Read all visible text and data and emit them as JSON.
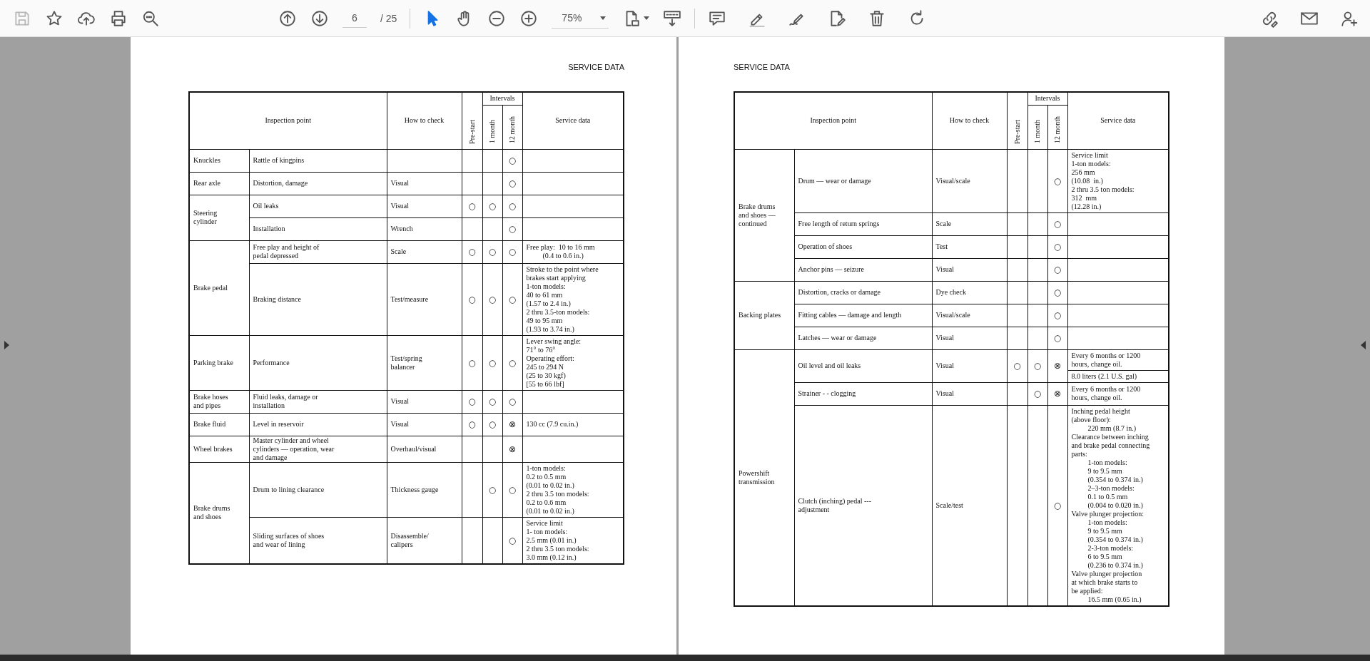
{
  "toolbar": {
    "file_buttons": [
      {
        "kind": "save",
        "disabled": true
      },
      {
        "kind": "bookmark",
        "disabled": false
      },
      {
        "kind": "upload",
        "disabled": false
      },
      {
        "kind": "print",
        "disabled": false
      },
      {
        "kind": "find",
        "disabled": false
      }
    ],
    "nav_buttons": [
      {
        "kind": "prev"
      },
      {
        "kind": "next"
      }
    ],
    "page_field": {
      "value": "6"
    },
    "page_count": "/ 25",
    "tools": [
      {
        "kind": "select",
        "selected": true
      },
      {
        "kind": "hand",
        "selected": false
      }
    ],
    "zoom_buttons": [
      {
        "kind": "zoom_out"
      },
      {
        "kind": "zoom_in"
      }
    ],
    "zoom_field": {
      "value": "75%"
    },
    "view_buttons": [
      {
        "kind": "fit"
      },
      {
        "kind": "scroll"
      }
    ],
    "edit_buttons": [
      {
        "kind": "comment"
      },
      {
        "kind": "highlight"
      },
      {
        "kind": "sign"
      },
      {
        "kind": "edit"
      },
      {
        "kind": "delete"
      },
      {
        "kind": "rotate"
      }
    ],
    "share_buttons": [
      {
        "kind": "link"
      },
      {
        "kind": "mail"
      },
      {
        "kind": "user"
      }
    ]
  },
  "pages": [
    {
      "heading": "SERVICE DATA",
      "columns": {
        "inspection": "Inspection point",
        "check": "How to check",
        "pre_start": "Pre-start",
        "intervals": "Intervals",
        "month_1": "1 month",
        "month_12": "12 month",
        "service": "Service data"
      },
      "groups": [
        {
          "name": "Knuckles",
          "rows": [
            {
              "inspection": "Rattle of kingpins",
              "intervals": {
                "month_12": "○"
              }
            }
          ]
        },
        {
          "name": "Rear axle",
          "rows": [
            {
              "inspection": "Distortion, damage",
              "check": "Visual",
              "intervals": {
                "month_12": "○"
              }
            }
          ]
        },
        {
          "name": "Steering\ncylinder",
          "rows": [
            {
              "inspection": "Oil leaks",
              "check": "Visual",
              "intervals": {
                "pre_start": "○",
                "month_1": "○",
                "month_12": "○"
              }
            },
            {
              "inspection": "Installation",
              "check": "Wrench",
              "intervals": {
                "month_12": "○"
              }
            }
          ]
        },
        {
          "name": "Brake pedal",
          "rows": [
            {
              "inspection": "Free play and height of\npedal depressed",
              "check": "Scale",
              "intervals": {
                "pre_start": "○",
                "month_1": "○",
                "month_12": "○"
              },
              "service_data": [
                [
                  "Free play:  10 to 16 mm",
                  {
                    "text": "(0.4 to 0.6 in.)",
                    "indent": true
                  }
                ]
              ]
            },
            {
              "inspection": "Braking distance",
              "check": "Test/measure",
              "intervals": {
                "pre_start": "○",
                "month_1": "○",
                "month_12": "○"
              },
              "service_data": [
                [
                  "Stroke to the point where",
                  "brakes start applying",
                  "1-ton models:",
                  "40 to 61 mm",
                  "(1.57 to 2.4 in.)",
                  "2 thru 3.5-ton models:",
                  "49 to 95 mm",
                  "(1.93 to 3.74 in.)"
                ]
              ]
            }
          ]
        },
        {
          "name": "Parking brake",
          "rows": [
            {
              "inspection": "Performance",
              "check": "Test/spring\nbalancer",
              "intervals": {
                "pre_start": "○",
                "month_1": "○",
                "month_12": "○"
              },
              "service_data": [
                [
                  "Lever swing angle:",
                  "71° to 76°",
                  "Operating effort:",
                  "245 to 294 N",
                  "(25 to 30 kgf)",
                  "[55 to 66 lbf]"
                ]
              ]
            }
          ]
        },
        {
          "name": "Brake hoses\nand pipes",
          "rows": [
            {
              "inspection": "Fluid leaks, damage or\ninstallation",
              "check": "Visual",
              "intervals": {
                "pre_start": "○",
                "month_1": "○",
                "month_12": "○"
              }
            }
          ]
        },
        {
          "name": "Brake fluid",
          "rows": [
            {
              "inspection": "Level in reservoir",
              "check": "Visual",
              "intervals": {
                "pre_start": "○",
                "month_1": "○",
                "month_12": "⊗"
              },
              "service_data": [
                [
                  "130 cc (7.9 cu.in.)"
                ]
              ]
            }
          ]
        },
        {
          "name": "Wheel brakes",
          "rows": [
            {
              "inspection": "Master cylinder and wheel\ncylinders — operation, wear\nand damage",
              "check": "Overhaul/visual",
              "intervals": {
                "month_12": "⊗"
              }
            }
          ]
        },
        {
          "name": "Brake drums\nand shoes",
          "rows": [
            {
              "inspection": "Drum to lining clearance",
              "check": "Thickness gauge",
              "intervals": {
                "month_1": "○",
                "month_12": "○"
              },
              "service_data": [
                [
                  "1-ton models:",
                  "0.2 to 0.5 mm",
                  "(0.01 to 0.02 in.)",
                  "2 thru 3.5 ton models:",
                  "0.2 to 0.6 mm",
                  "(0.01 to 0.02 in.)"
                ]
              ]
            },
            {
              "inspection": "Sliding surfaces of shoes\nand wear of lining",
              "check": "Disassemble/\ncalipers",
              "intervals": {
                "month_12": "○"
              },
              "service_data": [
                [
                  "Service limit",
                  "1- ton models:",
                  "2.5 mm (0.01 in.)",
                  "2 thru 3.5 ton models:",
                  "3.0 mm (0.12 in.)"
                ]
              ]
            }
          ]
        }
      ]
    },
    {
      "heading": "SERVICE DATA",
      "columns": {
        "inspection": "Inspection point",
        "check": "How to check",
        "pre_start": "Pre-start",
        "intervals": "Intervals",
        "month_1": "1 month",
        "month_12": "12 month",
        "service": "Service data"
      },
      "groups": [
        {
          "name": "Brake drums\nand shoes —\ncontinued",
          "rows": [
            {
              "inspection": "Drum — wear or damage",
              "check": "Visual/scale",
              "intervals": {
                "month_12": "○"
              },
              "service_data": [
                [
                  "Service limit",
                  "1-ton models:",
                  "256 mm",
                  "(10.08  in.)",
                  "2 thru 3.5 ton models:",
                  "312  mm",
                  "(12.28 in.)"
                ]
              ]
            },
            {
              "inspection": "Free length of return springs",
              "check": "Scale",
              "intervals": {
                "month_12": "○"
              }
            },
            {
              "inspection": "Operation of shoes",
              "check": "Test",
              "intervals": {
                "month_12": "○"
              }
            },
            {
              "inspection": "Anchor pins — seizure",
              "check": "Visual",
              "intervals": {
                "month_12": "○"
              }
            }
          ]
        },
        {
          "name": "Backing plates",
          "rows": [
            {
              "inspection": "Distortion, cracks or damage",
              "check": "Dye check",
              "intervals": {
                "month_12": "○"
              }
            },
            {
              "inspection": "Fitting cables — damage and length",
              "check": "Visual/scale",
              "intervals": {
                "month_12": "○"
              }
            },
            {
              "inspection": "Latches — wear or damage",
              "check": "Visual",
              "intervals": {
                "month_12": "○"
              }
            }
          ]
        },
        {
          "name": "Powershift\ntransmission",
          "rows": [
            {
              "inspection": "Oil level and oil leaks",
              "check": "Visual",
              "intervals": {
                "pre_start": "○",
                "month_1": "○",
                "month_12": "⊗"
              },
              "service_data": [
                [
                  "Every 6 months or 1200",
                  "hours, change oil."
                ],
                [
                  "8.0 liters (2.1 U.S. gal)"
                ]
              ]
            },
            {
              "inspection": "Strainer - - clogging",
              "check": "Visual",
              "intervals": {
                "month_1": "○",
                "month_12": "⊗"
              },
              "service_data": [
                [
                  "Every 6 months or 1200",
                  "hours, change oil."
                ]
              ]
            },
            {
              "inspection": "Clutch (inching) pedal ---\nadjustment",
              "check": "Scale/test",
              "intervals": {
                "month_12": "○"
              },
              "service_data": [
                [
                  "Inching pedal height",
                  "(above floor):",
                  {
                    "text": "220 mm (8.7 in.)",
                    "indent": true
                  },
                  "Clearance between inching",
                  "and brake pedal connecting",
                  "parts:",
                  {
                    "text": "1-ton models:",
                    "indent": true
                  },
                  {
                    "text": "9 to 9.5 mm",
                    "indent": true
                  },
                  {
                    "text": "(0.354 to 0.374 in.)",
                    "indent": true
                  },
                  {
                    "text": "2–3-ton models:",
                    "indent": true
                  },
                  {
                    "text": "0.1 to 0.5 mm",
                    "indent": true
                  },
                  {
                    "text": "(0.004 to 0.020 in.)",
                    "indent": true
                  },
                  "Valve plunger projection:",
                  {
                    "text": "1-ton models:",
                    "indent": true
                  },
                  {
                    "text": "9 to 9.5 mm",
                    "indent": true
                  },
                  {
                    "text": "(0.354 to 0.374 in.)",
                    "indent": true
                  },
                  {
                    "text": "2-3-ton models:",
                    "indent": true
                  },
                  {
                    "text": "6 to 9.5 mm",
                    "indent": true
                  },
                  {
                    "text": "(0.236 to 0.374 in.)",
                    "indent": true
                  },
                  "Valve plunger projection",
                  "at which brake starts to",
                  "be applied:",
                  {
                    "text": "16.5 mm (0.65 in.)",
                    "indent": true
                  }
                ]
              ]
            }
          ]
        }
      ]
    }
  ]
}
